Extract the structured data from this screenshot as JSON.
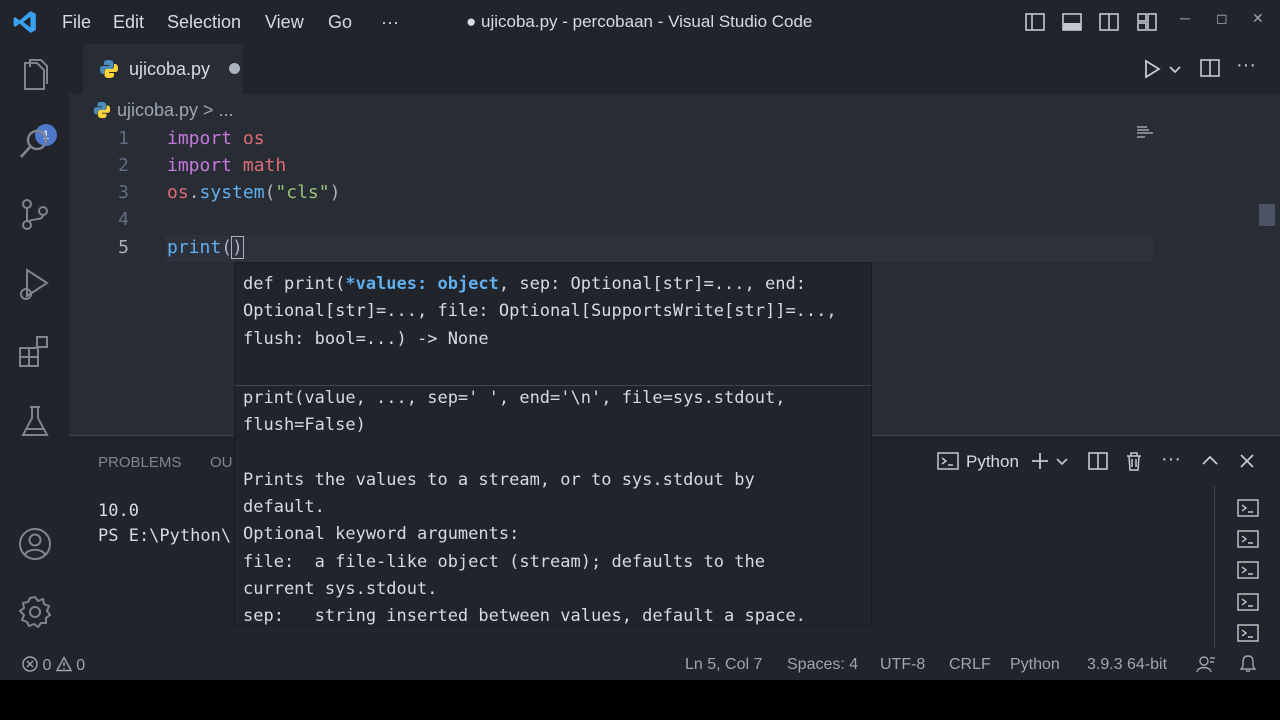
{
  "titlebar": {
    "menu": [
      "File",
      "Edit",
      "Selection",
      "View",
      "Go",
      "···"
    ],
    "title": "● ujicoba.py - percobaan - Visual Studio Code",
    "window_controls": [
      "─",
      "◻",
      "✕"
    ]
  },
  "activity_bar": {
    "explorer_badge": "1",
    "icons": [
      "explorer-icon",
      "search-icon",
      "source-control-icon",
      "run-debug-icon",
      "extensions-icon",
      "testing-icon",
      "account-icon",
      "settings-gear-icon"
    ]
  },
  "editor": {
    "tab": {
      "label": "ujicoba.py",
      "dirty": true
    },
    "breadcrumb": "ujicoba.py > ...",
    "line_numbers": [
      "1",
      "2",
      "3",
      "4",
      "5"
    ],
    "cursor_line": 5
  },
  "hover": {
    "signature_prefix": "def print(",
    "signature_param": "*values: object",
    "signature_rest": ", sep: Optional[str]=..., end: Optional[str]=..., file: Optional[SupportsWrite[str]]=..., flush: bool=...) -> None",
    "doc": "print(value, ..., sep=' ', end='\\n', file=sys.stdout,\nflush=False)\n\nPrints the values to a stream, or to sys.stdout by\ndefault.\nOptional keyword arguments:\nfile:  a file-like object (stream); defaults to the\ncurrent sys.stdout.\nsep:   string inserted between values, default a space."
  },
  "panel": {
    "tabs": [
      "PROBLEMS",
      "OU"
    ],
    "terminal_profile": "Python",
    "terminal_lines": [
      "10.0",
      "PS E:\\Python\\"
    ]
  },
  "statusbar": {
    "errors": "0",
    "warnings": "0",
    "position": "Ln 5, Col 7",
    "spaces": "Spaces: 4",
    "encoding": "UTF-8",
    "eol": "CRLF",
    "language": "Python",
    "interpreter": "3.9.3 64-bit"
  },
  "colors": {
    "accent": "#4d78cc",
    "keyword": "#c678dd",
    "function": "#61afef",
    "string": "#98c379",
    "background": "#282c34"
  }
}
